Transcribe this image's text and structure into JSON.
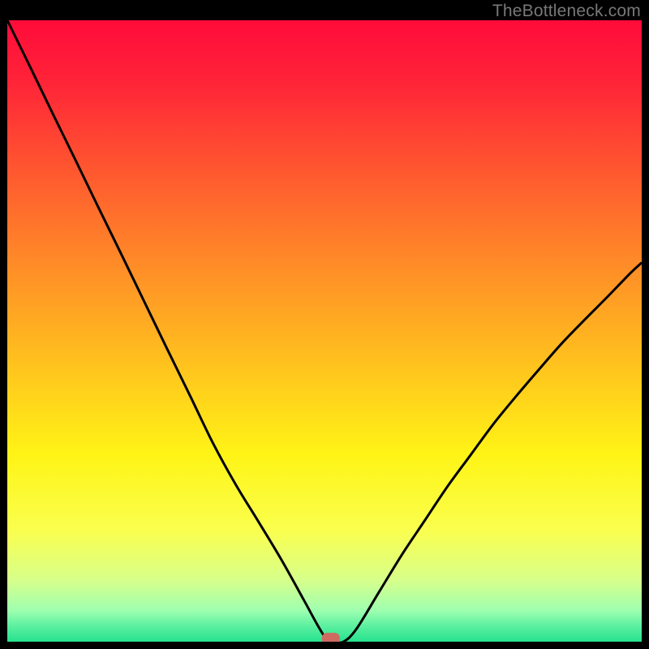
{
  "watermark": "TheBottleneck.com",
  "chart_data": {
    "type": "line",
    "title": "",
    "xlabel": "",
    "ylabel": "",
    "xlim": [
      0,
      100
    ],
    "ylim": [
      0,
      100
    ],
    "grid": false,
    "legend": false,
    "background": {
      "type": "vertical-gradient",
      "stops": [
        {
          "pos": 0.0,
          "color": "#ff0b3a"
        },
        {
          "pos": 0.1,
          "color": "#ff2438"
        },
        {
          "pos": 0.25,
          "color": "#ff5a2f"
        },
        {
          "pos": 0.4,
          "color": "#ff8e27"
        },
        {
          "pos": 0.55,
          "color": "#ffc11e"
        },
        {
          "pos": 0.7,
          "color": "#fff416"
        },
        {
          "pos": 0.82,
          "color": "#faff4e"
        },
        {
          "pos": 0.9,
          "color": "#d8ff8a"
        },
        {
          "pos": 0.95,
          "color": "#9effb0"
        },
        {
          "pos": 0.975,
          "color": "#5bf0a0"
        },
        {
          "pos": 1.0,
          "color": "#26e28e"
        }
      ]
    },
    "series": [
      {
        "name": "bottleneck-curve",
        "color": "#000000",
        "x": [
          0.0,
          3.6,
          7.2,
          10.8,
          14.4,
          18.0,
          21.6,
          25.2,
          28.8,
          32.4,
          36.0,
          39.6,
          43.2,
          46.8,
          49.0,
          50.4,
          51.5,
          53.0,
          55.0,
          58.6,
          62.2,
          65.8,
          69.4,
          73.0,
          76.6,
          80.2,
          83.8,
          87.4,
          91.0,
          94.6,
          98.2,
          100.0
        ],
        "y": [
          100.0,
          92.5,
          84.9,
          77.4,
          69.8,
          62.3,
          54.7,
          47.1,
          39.6,
          32.0,
          25.3,
          19.3,
          13.2,
          6.6,
          2.5,
          0.3,
          0.0,
          0.0,
          2.0,
          8.0,
          14.0,
          19.5,
          25.0,
          30.0,
          35.0,
          39.5,
          43.8,
          48.0,
          51.8,
          55.5,
          59.3,
          61.0
        ]
      }
    ],
    "marker": {
      "name": "optimal-point",
      "x": 51.0,
      "y": 0.5,
      "color": "#cf6a61",
      "shape": "rounded-rect"
    }
  }
}
